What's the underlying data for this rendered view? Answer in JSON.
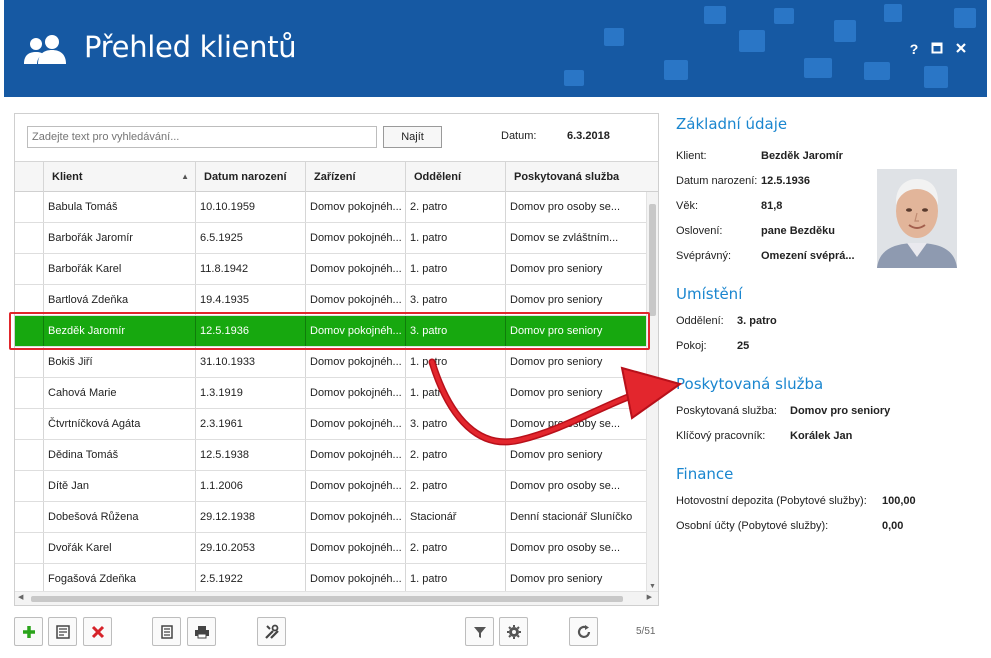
{
  "header": {
    "title": "Přehled klientů",
    "help": "?",
    "maximize": "□",
    "close": "✕"
  },
  "search": {
    "placeholder": "Zadejte text pro vyhledávání...",
    "button": "Najít",
    "date_label": "Datum:",
    "date_value": "6.3.2018"
  },
  "grid": {
    "columns": [
      "Klient",
      "Datum narození",
      "Zařízení",
      "Oddělení",
      "Poskytovaná služba"
    ],
    "rows": [
      [
        "Babula Tomáš",
        "10.10.1959",
        "Domov pokojnéh...",
        "2. patro",
        "Domov pro osoby se..."
      ],
      [
        "Barbořák Jaromír",
        "6.5.1925",
        "Domov pokojnéh...",
        "1. patro",
        "Domov se zvláštním..."
      ],
      [
        "Barbořák Karel",
        "11.8.1942",
        "Domov pokojnéh...",
        "1. patro",
        "Domov pro seniory"
      ],
      [
        "Bartlová Zdeňka",
        "19.4.1935",
        "Domov pokojnéh...",
        "3. patro",
        "Domov pro seniory"
      ],
      [
        "Bezděk Jaromír",
        "12.5.1936",
        "Domov pokojnéh...",
        "3. patro",
        "Domov pro seniory"
      ],
      [
        "Bokiš Jiří",
        "31.10.1933",
        "Domov pokojnéh...",
        "1. patro",
        "Domov pro seniory"
      ],
      [
        "Cahová Marie",
        "1.3.1919",
        "Domov pokojnéh...",
        "1. patro",
        "Domov pro seniory"
      ],
      [
        "Čtvrtníčková Agáta",
        "2.3.1961",
        "Domov pokojnéh...",
        "3. patro",
        "Domov pro osoby se..."
      ],
      [
        "Dědina Tomáš",
        "12.5.1938",
        "Domov pokojnéh...",
        "2. patro",
        "Domov pro seniory"
      ],
      [
        "Dítě Jan",
        "1.1.2006",
        "Domov pokojnéh...",
        "2. patro",
        "Domov pro osoby se..."
      ],
      [
        "Dobešová Růžena",
        "29.12.1938",
        "Domov pokojnéh...",
        "Stacionář",
        "Denní stacionář Sluníčko"
      ],
      [
        "Dvořák Karel",
        "29.10.2053",
        "Domov pokojnéh...",
        "2. patro",
        "Domov pro osoby se..."
      ],
      [
        "Fogašová Zdeňka",
        "2.5.1922",
        "Domov pokojnéh...",
        "1. patro",
        "Domov pro seniory"
      ]
    ],
    "selected_row": 4,
    "count": "5/51"
  },
  "toolbar": [
    "add-icon",
    "edit-icon",
    "delete-icon",
    "report-icon",
    "print-icon",
    "tools-icon",
    "filter-icon",
    "settings-icon",
    "refresh-icon"
  ],
  "details": {
    "basic": {
      "title": "Základní údaje",
      "client_label": "Klient:",
      "client": "Bezděk Jaromír",
      "dob_label": "Datum narození:",
      "dob": "12.5.1936",
      "age_label": "Věk:",
      "age": "81,8",
      "salutation_label": "Oslovení:",
      "salutation": "pane Bezděku",
      "competence_label": "Svéprávný:",
      "competence": "Omezení svéprá..."
    },
    "location": {
      "title": "Umístění",
      "dept_label": "Oddělení:",
      "dept": "3. patro",
      "room_label": "Pokoj:",
      "room": "25"
    },
    "service": {
      "title": "Poskytovaná služba",
      "service_label": "Poskytovaná služba:",
      "service": "Domov pro seniory",
      "worker_label": "Klíčový pracovník:",
      "worker": "Korálek Jan"
    },
    "finance": {
      "title": "Finance",
      "deposit_label": "Hotovostní depozita (Pobytové služby):",
      "deposit": "100,00",
      "accounts_label": "Osobní účty (Pobytové služby):",
      "accounts": "0,00"
    }
  },
  "colors": {
    "header": "#1659a3",
    "selected": "#17a80f",
    "accent": "#1a86cf",
    "highlight": "#e0262b"
  }
}
